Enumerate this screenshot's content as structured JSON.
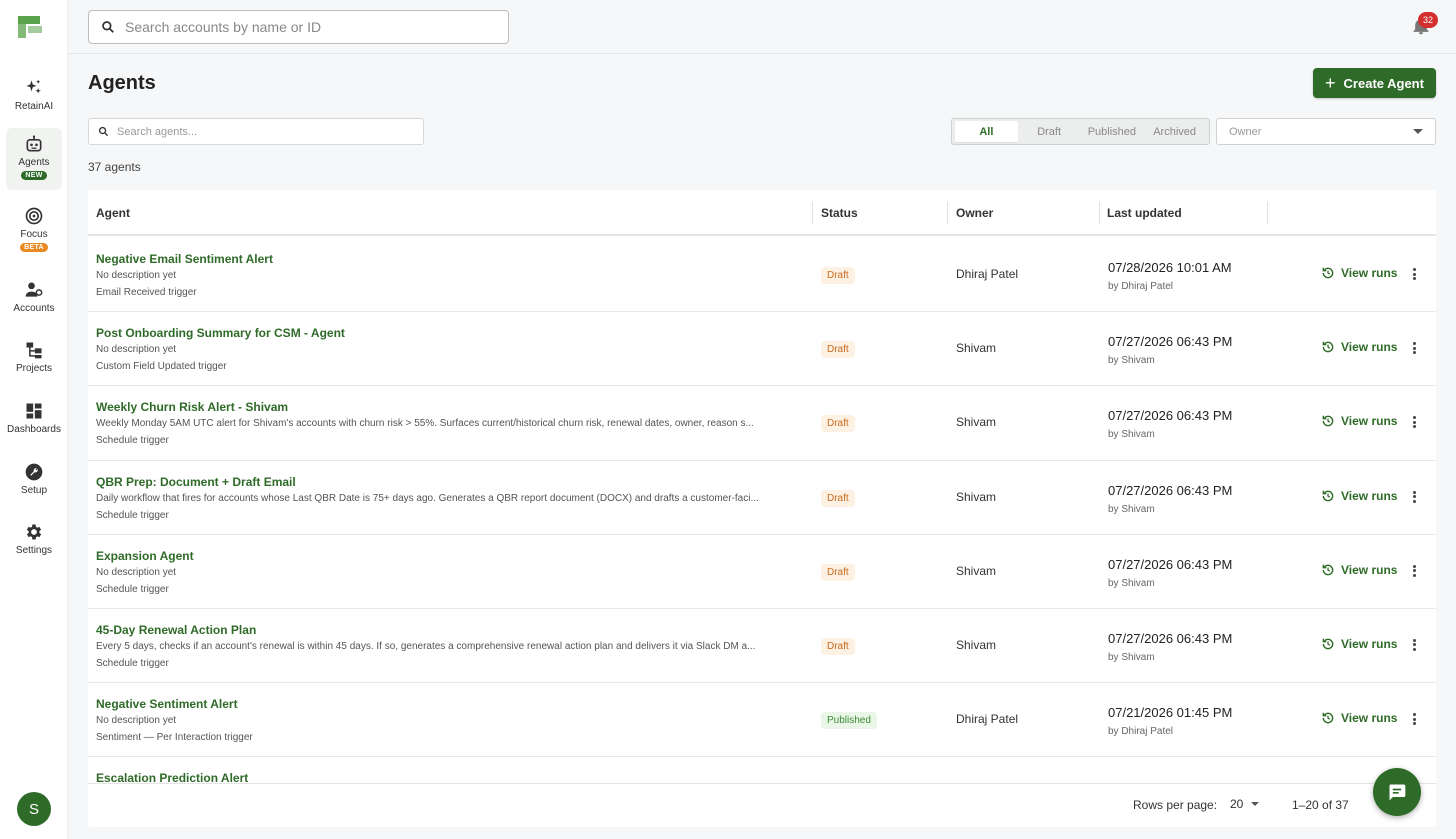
{
  "sidebar": {
    "items": [
      {
        "label": "RetainAI",
        "icon": "sparkles-icon"
      },
      {
        "label": "Agents",
        "icon": "robot-icon",
        "badge": "NEW"
      },
      {
        "label": "Focus",
        "icon": "target-icon",
        "badge": "BETA"
      },
      {
        "label": "Accounts",
        "icon": "accounts-icon"
      },
      {
        "label": "Projects",
        "icon": "projects-icon"
      },
      {
        "label": "Dashboards",
        "icon": "dashboard-icon"
      },
      {
        "label": "Setup",
        "icon": "wrench-icon"
      },
      {
        "label": "Settings",
        "icon": "gear-icon"
      }
    ],
    "avatar_initial": "S"
  },
  "topbar": {
    "search_placeholder": "Search accounts by name or ID",
    "notification_count": "32"
  },
  "page": {
    "title": "Agents",
    "create_button": "Create Agent",
    "agent_search_placeholder": "Search agents...",
    "filters": [
      "All",
      "Draft",
      "Published",
      "Archived"
    ],
    "active_filter": "All",
    "owner_placeholder": "Owner",
    "count_text": "37 agents"
  },
  "table": {
    "columns": [
      "Agent",
      "Status",
      "Owner",
      "Last updated"
    ],
    "view_runs_label": "View runs",
    "rows": [
      {
        "name": "Negative Email Sentiment Alert",
        "description": "No description yet",
        "trigger": "Email Received trigger",
        "status": "Draft",
        "owner": "Dhiraj Patel",
        "updated": "07/28/2026 10:01 AM",
        "updated_by": "by Dhiraj Patel"
      },
      {
        "name": "Post Onboarding Summary for CSM - Agent",
        "description": "No description yet",
        "trigger": "Custom Field Updated trigger",
        "status": "Draft",
        "owner": "Shivam",
        "updated": "07/27/2026 06:43 PM",
        "updated_by": "by Shivam"
      },
      {
        "name": "Weekly Churn Risk Alert - Shivam",
        "description": "Weekly Monday 5AM UTC alert for Shivam's accounts with churn risk > 55%. Surfaces current/historical churn risk, renewal dates, owner, reason s...",
        "trigger": "Schedule trigger",
        "status": "Draft",
        "owner": "Shivam",
        "updated": "07/27/2026 06:43 PM",
        "updated_by": "by Shivam"
      },
      {
        "name": "QBR Prep: Document + Draft Email",
        "description": "Daily workflow that fires for accounts whose Last QBR Date is 75+ days ago. Generates a QBR report document (DOCX) and drafts a customer-faci...",
        "trigger": "Schedule trigger",
        "status": "Draft",
        "owner": "Shivam",
        "updated": "07/27/2026 06:43 PM",
        "updated_by": "by Shivam"
      },
      {
        "name": "Expansion Agent",
        "description": "No description yet",
        "trigger": "Schedule trigger",
        "status": "Draft",
        "owner": "Shivam",
        "updated": "07/27/2026 06:43 PM",
        "updated_by": "by Shivam"
      },
      {
        "name": "45-Day Renewal Action Plan",
        "description": "Every 5 days, checks if an account's renewal is within 45 days. If so, generates a comprehensive renewal action plan and delivers it via Slack DM a...",
        "trigger": "Schedule trigger",
        "status": "Draft",
        "owner": "Shivam",
        "updated": "07/27/2026 06:43 PM",
        "updated_by": "by Shivam"
      },
      {
        "name": "Negative Sentiment Alert",
        "description": "No description yet",
        "trigger": "Sentiment — Per Interaction trigger",
        "status": "Published",
        "owner": "Dhiraj Patel",
        "updated": "07/21/2026 01:45 PM",
        "updated_by": "by Dhiraj Patel"
      },
      {
        "name": "Escalation Prediction Alert"
      }
    ]
  },
  "pagination": {
    "rows_per_page_label": "Rows per page:",
    "rows_per_page": "20",
    "range": "1–20 of 37"
  },
  "colors": {
    "brand_green": "#2f6b28",
    "draft_text": "#c96a1c",
    "published_text": "#3c8a33"
  }
}
